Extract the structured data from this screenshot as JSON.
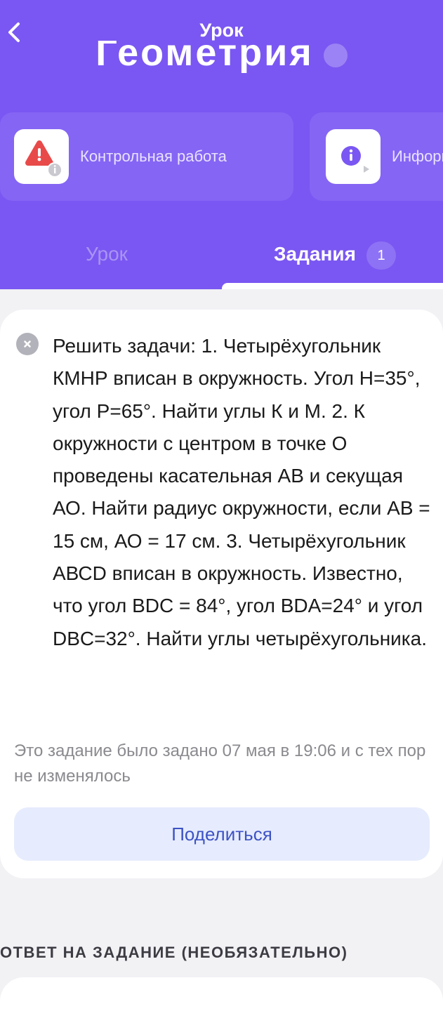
{
  "header": {
    "title": "Урок",
    "subject": "Геометрия",
    "cards": [
      {
        "label": "Контрольная работа",
        "icon": "warning-triangle-icon"
      },
      {
        "label": "Информация",
        "icon": "info-play-icon"
      }
    ],
    "tabs": [
      {
        "label": "Урок",
        "active": false
      },
      {
        "label": "Задания",
        "active": true,
        "count": "1"
      }
    ]
  },
  "task": {
    "status_icon": "close-circle-icon",
    "text": "Решить задачи: 1. Четырёхугольник КМНР вписан в окружность. Угол Н=35°, угол Р=65°. Найти углы К и М. 2. К окружности с центром в точке О проведены касательная АВ и секущая АО. Найти радиус окружности, если АВ = 15 см, АО = 17 см. 3. Четырёхугольник АВСD вписан в окружность. Известно, что угол ВDC = 84°, угол  BDA=24° и угол DBC=32°. Найти углы четырёхугольника.",
    "meta": "Это задание было задано 07 мая в 19:06 и с тех пор не изменялось",
    "share_label": "Поделиться"
  },
  "answer": {
    "heading": "ОТВЕТ НА ЗАДАНИЕ (НЕОБЯЗАТЕЛЬНО)"
  },
  "colors": {
    "brand": "#7A57F2",
    "warning": "#E84A4A",
    "info": "#7A57F2",
    "share_text": "#3D52C4"
  }
}
